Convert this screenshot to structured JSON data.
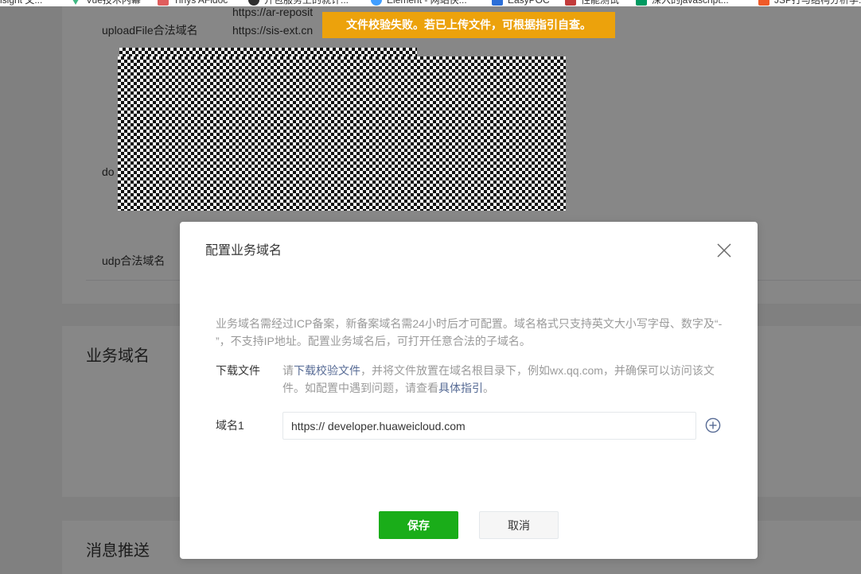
{
  "browser": {
    "bookmarks": [
      {
        "label": "isight 文..."
      },
      {
        "label": "Vue技术内幕",
        "icon": "vue-logo-icon",
        "icon_color": "#41b883"
      },
      {
        "label": "Tinys AFidoc",
        "icon": "tinys-favicon-icon",
        "icon_color": "#e05d5d"
      },
      {
        "label": "开包服务上的就计...",
        "icon": "site-favicon-icon",
        "icon_color": "#2f2f2f"
      },
      {
        "label": "Element - 网站快...",
        "icon": "element-logo-icon",
        "icon_color": "#409eff"
      },
      {
        "label": "EasyPOC",
        "icon": "easypoc-favicon-icon",
        "icon_color": "#2c6fd8"
      },
      {
        "label": "性能测试",
        "icon": "performance-test-favicon-icon",
        "icon_color": "#c23b3b"
      },
      {
        "label": "深入的javascript...",
        "icon": "segmentfault-favicon-icon",
        "icon_color": "#009a61"
      },
      {
        "label": "JSP打与结构分析学...",
        "icon": "site-favicon-icon",
        "icon_color": "#f05a28"
      }
    ]
  },
  "server_domains": {
    "upload_label": "uploadFile合法域名",
    "upload_domains": [
      "https://ar-reposit",
      "https://sis-ext.cn"
    ],
    "download_label": "do",
    "udp_label": "udp合法域名"
  },
  "sections": {
    "business_domain_heading": "业务域名",
    "message_push_heading": "消息推送"
  },
  "toast": {
    "message": "文件校验失败。若已上传文件，可根据指引自查。",
    "color": "#eca20c"
  },
  "dialog": {
    "title": "配置业务域名",
    "description": "业务域名需经过ICP备案，新备案域名需24小时后才可配置。域名格式只支持英文大小写字母、数字及“- ”，不支持IP地址。配置业务域名后，可打开任意合法的子域名。",
    "download": {
      "label": "下载文件",
      "text_before": "请",
      "link_file": "下载校验文件",
      "text_middle": "，并将文件放置在域名根目录下，例如wx.qq.com，并确保可以访问该文件。如配置中遇到问题，请查看",
      "link_guide": "具体指引",
      "text_after": "。"
    },
    "domain_row": {
      "label": "域名1",
      "value": "https:// developer.huaweicloud.com",
      "add_icon": "plus-circle-icon"
    },
    "save_label": "保存",
    "cancel_label": "取消",
    "close_icon": "close-icon"
  },
  "colors": {
    "accent_green": "#1aad19",
    "link": "#576b95",
    "overlay": "rgba(0,0,0,0.47)"
  }
}
